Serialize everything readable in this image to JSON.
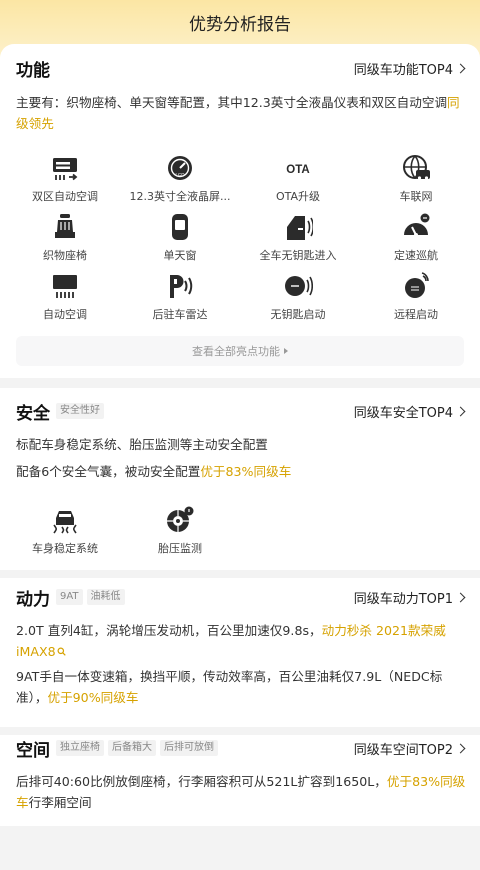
{
  "header": {
    "title": "优势分析报告"
  },
  "function": {
    "title": "功能",
    "rank": "同级车功能TOP4",
    "desc_text": "主要有：织物座椅、单天窗等配置，其中12.3英寸全液晶仪表和双区自动空调",
    "desc_highlight": "同级领先",
    "features": [
      {
        "label": "双区自动空调",
        "icon": "dual-zone-ac-icon"
      },
      {
        "label": "12.3英寸全液晶屏...",
        "icon": "lcd-gauge-icon"
      },
      {
        "label": "OTA升级",
        "icon": "ota-icon"
      },
      {
        "label": "车联网",
        "icon": "connected-car-icon"
      },
      {
        "label": "织物座椅",
        "icon": "fabric-seat-icon"
      },
      {
        "label": "单天窗",
        "icon": "sunroof-icon"
      },
      {
        "label": "全车无钥匙进入",
        "icon": "keyless-entry-icon"
      },
      {
        "label": "定速巡航",
        "icon": "cruise-control-icon"
      },
      {
        "label": "自动空调",
        "icon": "auto-ac-icon"
      },
      {
        "label": "后驻车雷达",
        "icon": "parking-radar-icon"
      },
      {
        "label": "无钥匙启动",
        "icon": "keyless-start-icon"
      },
      {
        "label": "远程启动",
        "icon": "remote-start-icon"
      }
    ],
    "ota_text": "OTA",
    "more_label": "查看全部亮点功能"
  },
  "safety": {
    "title": "安全",
    "tag": "安全性好",
    "rank": "同级车安全TOP4",
    "line1": "标配车身稳定系统、胎压监测等主动安全配置",
    "line2_text": "配备6个安全气囊，被动安全配置",
    "line2_highlight": "优于83%同级车",
    "features": [
      {
        "label": "车身稳定系统",
        "icon": "stability-control-icon"
      },
      {
        "label": "胎压监测",
        "icon": "tire-pressure-icon"
      }
    ]
  },
  "power": {
    "title": "动力",
    "tags": [
      "9AT",
      "油耗低"
    ],
    "rank": "同级车动力TOP1",
    "line1_text": "2.0T 直列4缸，涡轮增压发动机，百公里加速仅9.8s，",
    "line1_highlight": "动力秒杀 2021款荣威iMAX8",
    "line2_text": "9AT手自一体变速箱，换挡平顺，传动效率高，百公里油耗仅7.9L（NEDC标准），",
    "line2_highlight": "优于90%同级车"
  },
  "space": {
    "title": "空间",
    "tags": [
      "独立座椅",
      "后备箱大",
      "后排可放倒"
    ],
    "rank": "同级车空间TOP2",
    "line_text": "后排可40:60比例放倒座椅，行李厢容积可从521L扩容到1650L，",
    "line_highlight": "优于83%同级车",
    "line_tail": "行李厢空间"
  },
  "colors": {
    "accent": "#d6a200",
    "hero_top": "#fbe6a4"
  }
}
